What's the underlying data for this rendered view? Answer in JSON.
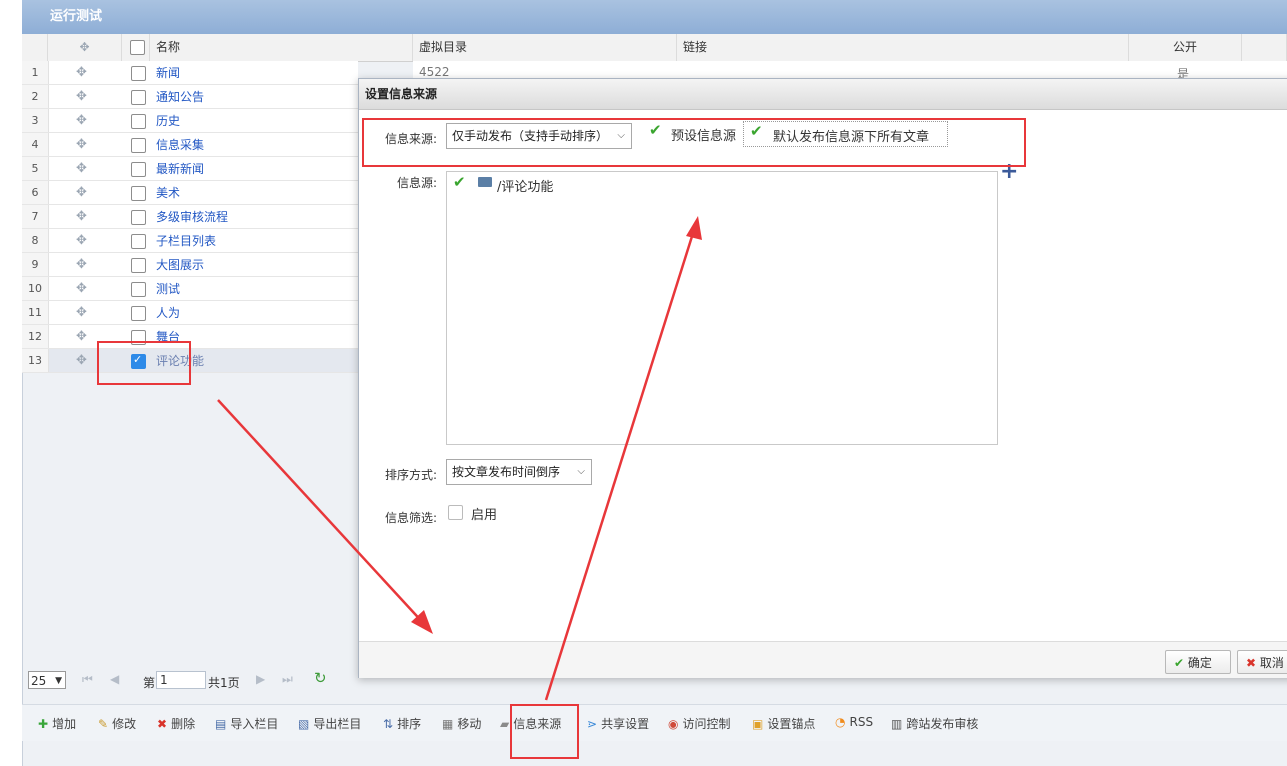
{
  "panel": {
    "title": "运行测试"
  },
  "grid": {
    "columns": {
      "name": "名称",
      "vdir": "虚拟目录",
      "link": "链接",
      "public": "公开"
    },
    "rows": [
      {
        "num": "1",
        "name": "新闻",
        "vdir": "4522",
        "public": "是"
      },
      {
        "num": "2",
        "name": "通知公告"
      },
      {
        "num": "3",
        "name": "历史"
      },
      {
        "num": "4",
        "name": "信息采集"
      },
      {
        "num": "5",
        "name": "最新新闻"
      },
      {
        "num": "6",
        "name": "美术"
      },
      {
        "num": "7",
        "name": "多级审核流程"
      },
      {
        "num": "8",
        "name": "子栏目列表"
      },
      {
        "num": "9",
        "name": "大图展示"
      },
      {
        "num": "10",
        "name": "测试"
      },
      {
        "num": "11",
        "name": "人为"
      },
      {
        "num": "12",
        "name": "舞台"
      },
      {
        "num": "13",
        "name": "评论功能",
        "selected": true
      }
    ]
  },
  "pager": {
    "page_size": "25",
    "page_prefix": "第",
    "page_value": "1",
    "total": "共1页"
  },
  "toolbar": {
    "items": [
      {
        "label": "增加",
        "icon": "plus-icon"
      },
      {
        "label": "修改",
        "icon": "pencil-icon"
      },
      {
        "label": "删除",
        "icon": "delete-icon"
      },
      {
        "label": "导入栏目",
        "icon": "import-icon"
      },
      {
        "label": "导出栏目",
        "icon": "export-icon"
      },
      {
        "label": "排序",
        "icon": "sort-icon"
      },
      {
        "label": "移动",
        "icon": "move-icon"
      },
      {
        "label": "信息来源",
        "icon": "source-icon"
      },
      {
        "label": "共享设置",
        "icon": "share-icon"
      },
      {
        "label": "访问控制",
        "icon": "access-icon"
      },
      {
        "label": "设置锚点",
        "icon": "anchor-icon"
      },
      {
        "label": "RSS",
        "icon": "rss-icon"
      },
      {
        "label": "跨站发布审核",
        "icon": "publish-review-icon"
      }
    ]
  },
  "dialog": {
    "title": "设置信息来源",
    "source_type_label": "信息来源:",
    "source_type_value": "仅手动发布（支持手动排序）",
    "preset_source_label": "预设信息源",
    "default_all_label": "默认发布信息源下所有文章",
    "source_label": "信息源:",
    "tree_item": "/评论功能",
    "sort_label": "排序方式:",
    "sort_value": "按文章发布时间倒序",
    "filter_label": "信息筛选:",
    "filter_enable_label": "启用",
    "ok_label": "确定",
    "cancel_label": "取消"
  },
  "colors": {
    "annotation": "#e8373a",
    "header": "#8eaed6",
    "link": "#2358c4"
  }
}
